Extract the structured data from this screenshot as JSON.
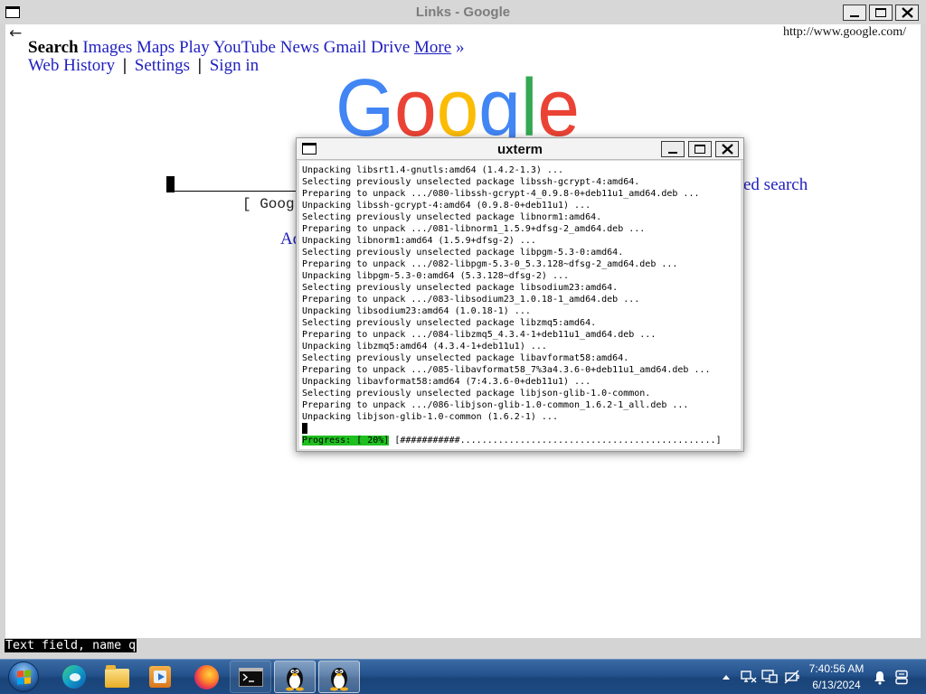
{
  "links_window": {
    "title": "Links - Google",
    "window_icon": "window-icon",
    "controls": [
      "minimize-icon",
      "maximize-icon",
      "close-icon"
    ],
    "back_arrow": "←",
    "url": "http://www.google.com/",
    "nav": {
      "current": "Search",
      "items": [
        "Images",
        "Maps",
        "Play",
        "YouTube",
        "News",
        "Gmail",
        "Drive"
      ],
      "more": "More",
      "more_arrow": "»"
    },
    "subnav": {
      "items": [
        "Web History",
        "Settings",
        "Sign in"
      ],
      "separator": "|"
    },
    "logo": {
      "text": "Google",
      "colors": [
        "#4285F4",
        "#EA4335",
        "#FBBC05",
        "#4285F4",
        "#34A853",
        "#EA4335"
      ]
    },
    "search_field": {
      "value": ""
    },
    "fragments": {
      "search_button": "[ Goog",
      "advanced_search": "ed search",
      "ad": "Ad"
    },
    "status_text": "Text field, name q",
    "link_color": "#1f1fbf"
  },
  "xterm": {
    "title": "uxterm",
    "controls": [
      "minimize-icon",
      "maximize-icon",
      "close-icon"
    ],
    "lines": [
      "Unpacking libsrt1.4-gnutls:amd64 (1.4.2-1.3) ...",
      "Selecting previously unselected package libssh-gcrypt-4:amd64.",
      "Preparing to unpack .../080-libssh-gcrypt-4_0.9.8-0+deb11u1_amd64.deb ...",
      "Unpacking libssh-gcrypt-4:amd64 (0.9.8-0+deb11u1) ...",
      "Selecting previously unselected package libnorm1:amd64.",
      "Preparing to unpack .../081-libnorm1_1.5.9+dfsg-2_amd64.deb ...",
      "Unpacking libnorm1:amd64 (1.5.9+dfsg-2) ...",
      "Selecting previously unselected package libpgm-5.3-0:amd64.",
      "Preparing to unpack .../082-libpgm-5.3-0_5.3.128~dfsg-2_amd64.deb ...",
      "Unpacking libpgm-5.3-0:amd64 (5.3.128~dfsg-2) ...",
      "Selecting previously unselected package libsodium23:amd64.",
      "Preparing to unpack .../083-libsodium23_1.0.18-1_amd64.deb ...",
      "Unpacking libsodium23:amd64 (1.0.18-1) ...",
      "Selecting previously unselected package libzmq5:amd64.",
      "Preparing to unpack .../084-libzmq5_4.3.4-1+deb11u1_amd64.deb ...",
      "Unpacking libzmq5:amd64 (4.3.4-1+deb11u1) ...",
      "Selecting previously unselected package libavformat58:amd64.",
      "Preparing to unpack .../085-libavformat58_7%3a4.3.6-0+deb11u1_amd64.deb ...",
      "Unpacking libavformat58:amd64 (7:4.3.6-0+deb11u1) ...",
      "Selecting previously unselected package libjson-glib-1.0-common.",
      "Preparing to unpack .../086-libjson-glib-1.0-common_1.6.2-1_all.deb ...",
      "Unpacking libjson-glib-1.0-common (1.6.2-1) ..."
    ],
    "progress": {
      "label": "Progress: [ 20%]",
      "bar": "[###########...............................................]",
      "percent": 20,
      "color": "#1fbf1f"
    }
  },
  "taskbar": {
    "apps": [
      {
        "icon": "windows-orb-icon"
      },
      {
        "icon": "edge-icon"
      },
      {
        "icon": "folder-icon"
      },
      {
        "icon": "media-player-icon"
      },
      {
        "icon": "firefox-icon"
      },
      {
        "icon": "terminal-icon"
      },
      {
        "icon": "tux-icon",
        "active": true
      },
      {
        "icon": "tux-icon",
        "active": true
      }
    ],
    "tray_icons": [
      "show-hidden-icons-icon",
      "network-icon",
      "display-icon",
      "power-icon",
      "notification-bell-icon",
      "action-center-icon"
    ],
    "clock": {
      "time": "7:40:56 AM",
      "date": "6/13/2024"
    }
  }
}
